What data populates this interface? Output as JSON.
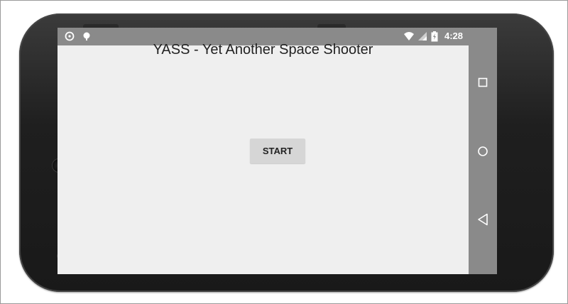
{
  "status_bar": {
    "time": "4:28",
    "icons": [
      "sync-icon",
      "android-debug-icon",
      "wifi-icon",
      "signal-icon",
      "battery-charging-icon"
    ]
  },
  "app": {
    "title": "YASS - Yet Another Space Shooter",
    "start_label": "START"
  },
  "nav_bar": {
    "icons": [
      "recents-icon",
      "home-icon",
      "back-icon"
    ]
  },
  "colors": {
    "status_bar": "#8a8a8a",
    "content_bg": "#efefef",
    "button_bg": "#d6d6d6"
  }
}
